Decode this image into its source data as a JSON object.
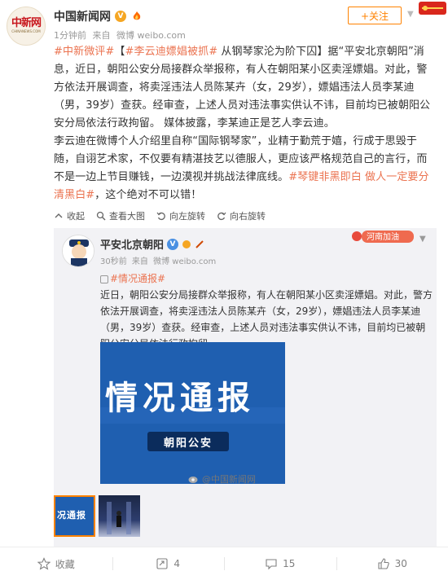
{
  "post": {
    "author": "中国新闻网",
    "time": "1分钟前",
    "source_prefix": "来自",
    "source": "微博 weibo.com",
    "follow_label": "+关注",
    "text_parts": [
      {
        "text": "#中新微评#",
        "type": "link"
      },
      {
        "text": "【",
        "type": "plain"
      },
      {
        "text": "#李云迪嫖娼被抓#",
        "type": "link"
      },
      {
        "text": " 从钢琴家沦为阶下囚】据“平安北京朝阳”消息，近日，朝阳公安分局接群众举报称，有人在朝阳某小区卖淫嫖娼。对此，警方依法开展调查，将卖淫违法人员陈某卉（女，29岁），嫖娼违法人员李某迪（男，39岁）查获。经审查，上述人员对违法事实供认不讳，目前均已被朝阳公安分局依法行政拘留。 媒体披露，李某迪正是艺人李云迪。",
        "type": "plain"
      },
      {
        "text": "\n李云迪在微博个人介绍里自称“国际钢琴家”，业精于勤荒于嬉，行成于思毁于随，自诩艺术家，不仅要有精湛技艺以德服人，更应该严格规范自己的言行，而不是一边上节目赚钱，一边漠视并挑战法律底线。",
        "type": "plain"
      },
      {
        "text": "#琴键非黑即白 做人一定要分清黑白#",
        "type": "link"
      },
      {
        "text": "，这个绝对不可以错！",
        "type": "plain"
      }
    ]
  },
  "toolbar": {
    "collapse": "收起",
    "view_large": "查看大图",
    "rotate_left": "向左旋转",
    "rotate_right": "向右旋转"
  },
  "repost": {
    "author": "平安北京朝阳",
    "time": "30秒前",
    "source_prefix": "来自",
    "source": "微博 weibo.com",
    "badge": "河南加油",
    "tag": "#情况通报#",
    "text": "近日，朝阳公安分局接群众举报称，有人在朝阳某小区卖淫嫖娼。对此，警方依法开展调查，将卖淫违法人员陈某卉（女，29岁），嫖娼违法人员李某迪（男，39岁）查获。经审查，上述人员对违法事实供认不讳，目前均已被朝阳公安分局依法行政拘留。",
    "image_title": "情况通报",
    "image_subtitle": "朝阳公安",
    "watermark": "@中国新闻网",
    "thumb_text": "况通报"
  },
  "footer": {
    "favorite": "收藏",
    "repost_count": "4",
    "comment_count": "15",
    "like_count": "30"
  },
  "colors": {
    "accent": "#ff8200",
    "link": "#eb7350",
    "notice_blue": "#1f5fb0"
  }
}
